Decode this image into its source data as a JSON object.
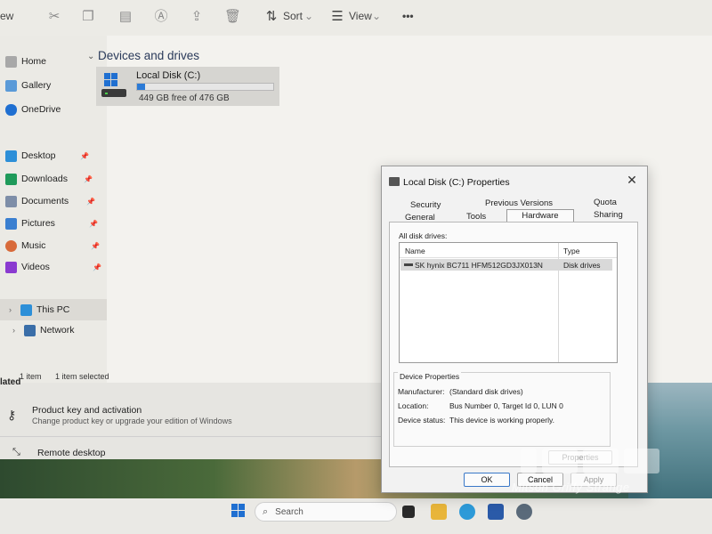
{
  "toolbar": {
    "view_partial": "ew",
    "sort": "Sort",
    "view": "View",
    "more": "•••"
  },
  "sidebar": {
    "items": [
      {
        "label": "Home"
      },
      {
        "label": "Gallery"
      },
      {
        "label": "OneDrive"
      },
      {
        "label": "Desktop"
      },
      {
        "label": "Downloads"
      },
      {
        "label": "Documents"
      },
      {
        "label": "Pictures"
      },
      {
        "label": "Music"
      },
      {
        "label": "Videos"
      },
      {
        "label": "This PC"
      },
      {
        "label": "Network"
      }
    ]
  },
  "content": {
    "group_title": "Devices and drives",
    "drive": {
      "name": "Local Disk (C:)",
      "free_text": "449 GB free of 476 GB",
      "used_fraction": 0.057
    }
  },
  "status": {
    "count": "1 item",
    "selected": "1 item selected"
  },
  "settings": {
    "partial_heading": "lated",
    "row1_title": "Product key and activation",
    "row1_sub": "Change product key or upgrade your edition of Windows",
    "row2_title": "Remote desktop"
  },
  "taskbar": {
    "search_placeholder": "Search"
  },
  "dialog": {
    "title": "Local Disk (C:) Properties",
    "close": "✕",
    "tabs_row1": [
      "Security",
      "Previous Versions",
      "Quota"
    ],
    "tabs_row2": [
      "General",
      "Tools",
      "Hardware",
      "Sharing"
    ],
    "all_drives_label": "All disk drives:",
    "columns": [
      "Name",
      "Type"
    ],
    "rows": [
      {
        "name": "SK hynix BC711 HFM512GD3JX013N",
        "type": "Disk drives"
      }
    ],
    "device_properties_title": "Device Properties",
    "manufacturer_label": "Manufacturer:",
    "manufacturer_value": "(Standard disk drives)",
    "location_label": "Location:",
    "location_value": "Bus Number 0, Target Id 0, LUN 0",
    "status_label": "Device status:",
    "status_value": "This device is working properly.",
    "properties_btn": "Properties",
    "ok_btn": "OK",
    "cancel_btn": "Cancel",
    "apply_btn": "Apply"
  },
  "watermark": {
    "line1": "Mitsoh Griffy Strange"
  },
  "colors": {
    "accent": "#2b7ad6"
  }
}
